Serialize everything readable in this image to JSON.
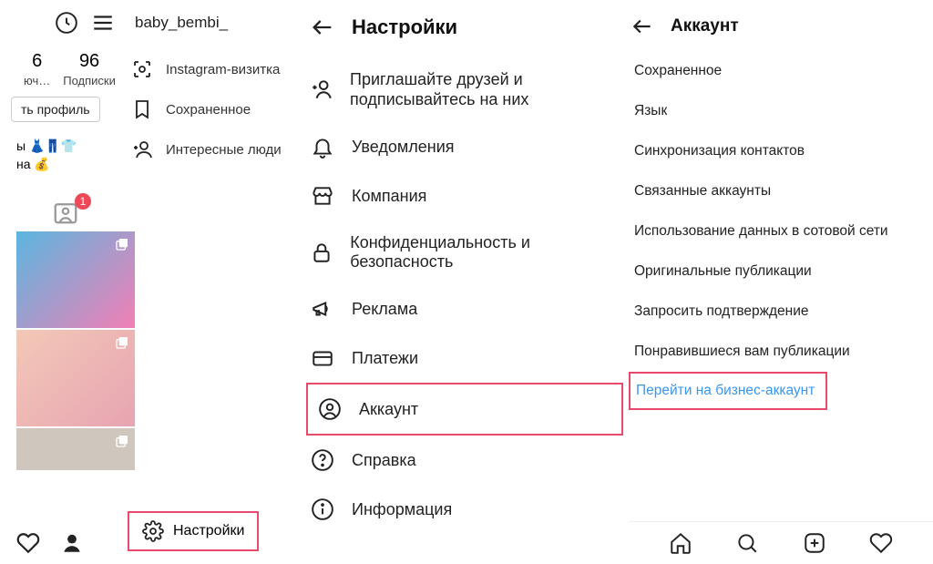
{
  "panel1": {
    "username": "baby_bembi_",
    "stat1_num": "6",
    "stat1_lbl": "юч…",
    "stat2_num": "96",
    "stat2_lbl": "Подписки",
    "edit_profile": "ть профиль",
    "bio_line1": "ы 👗👖👕",
    "bio_line2": "на 💰",
    "tag_badge": "1",
    "menu": {
      "nametag": "Instagram-визитка",
      "saved": "Сохраненное",
      "discover": "Интересные люди"
    },
    "settings": "Настройки"
  },
  "panel2": {
    "title": "Настройки",
    "items": {
      "invite": "Приглашайте друзей и подписывайтесь на них",
      "notifications": "Уведомления",
      "business": "Компания",
      "privacy": "Конфиденциальность и безопасность",
      "ads": "Реклама",
      "payments": "Платежи",
      "account": "Аккаунт",
      "help": "Справка",
      "about": "Информация"
    }
  },
  "panel3": {
    "title": "Аккаунт",
    "items": {
      "saved": "Сохраненное",
      "language": "Язык",
      "sync": "Синхронизация контактов",
      "linked": "Связанные аккаунты",
      "cellular": "Использование данных в сотовой сети",
      "original": "Оригинальные публикации",
      "verify": "Запросить подтверждение",
      "liked": "Понравившиеся вам публикации",
      "switch": "Перейти на бизнес-аккаунт"
    }
  }
}
